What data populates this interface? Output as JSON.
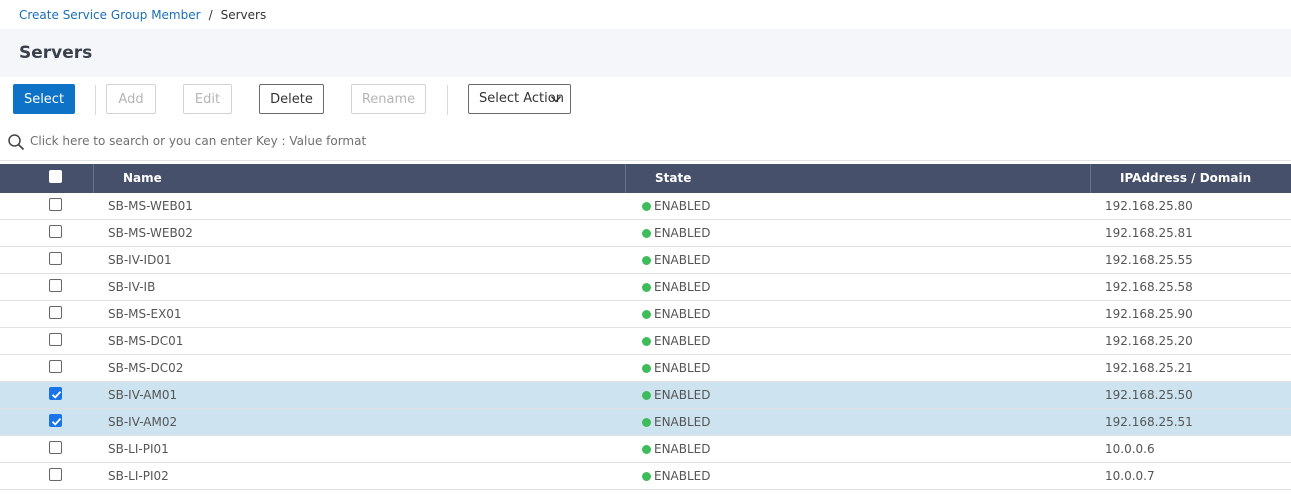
{
  "breadcrumb": {
    "parent": "Create Service Group Member",
    "separator": "/",
    "current": "Servers"
  },
  "page_title": "Servers",
  "toolbar": {
    "select_label": "Select",
    "add_label": "Add",
    "edit_label": "Edit",
    "delete_label": "Delete",
    "rename_label": "Rename",
    "select_action_label": "Select Action"
  },
  "search": {
    "placeholder": "Click here to search or you can enter Key : Value format"
  },
  "table": {
    "columns": {
      "name": "Name",
      "state": "State",
      "ip": "IPAddress / Domain"
    },
    "rows": [
      {
        "name": "SB-MS-WEB01",
        "state": "ENABLED",
        "ip": "192.168.25.80",
        "checked": false
      },
      {
        "name": "SB-MS-WEB02",
        "state": "ENABLED",
        "ip": "192.168.25.81",
        "checked": false
      },
      {
        "name": "SB-IV-ID01",
        "state": "ENABLED",
        "ip": "192.168.25.55",
        "checked": false
      },
      {
        "name": "SB-IV-IB",
        "state": "ENABLED",
        "ip": "192.168.25.58",
        "checked": false
      },
      {
        "name": "SB-MS-EX01",
        "state": "ENABLED",
        "ip": "192.168.25.90",
        "checked": false
      },
      {
        "name": "SB-MS-DC01",
        "state": "ENABLED",
        "ip": "192.168.25.20",
        "checked": false
      },
      {
        "name": "SB-MS-DC02",
        "state": "ENABLED",
        "ip": "192.168.25.21",
        "checked": false
      },
      {
        "name": "SB-IV-AM01",
        "state": "ENABLED",
        "ip": "192.168.25.50",
        "checked": true
      },
      {
        "name": "SB-IV-AM02",
        "state": "ENABLED",
        "ip": "192.168.25.51",
        "checked": true
      },
      {
        "name": "SB-LI-PI01",
        "state": "ENABLED",
        "ip": "10.0.0.6",
        "checked": false
      },
      {
        "name": "SB-LI-PI02",
        "state": "ENABLED",
        "ip": "10.0.0.7",
        "checked": false
      }
    ]
  },
  "colors": {
    "primary": "#0e72c6",
    "header_bg": "#47506a",
    "selected_row": "#cde4f0",
    "enabled_dot": "#3dbd5a",
    "link": "#1a6eb8"
  },
  "icons": {
    "search": "search-icon",
    "chevron": "chevron-down-icon",
    "checkmark": "checkmark-icon",
    "status": "status-dot-icon"
  }
}
